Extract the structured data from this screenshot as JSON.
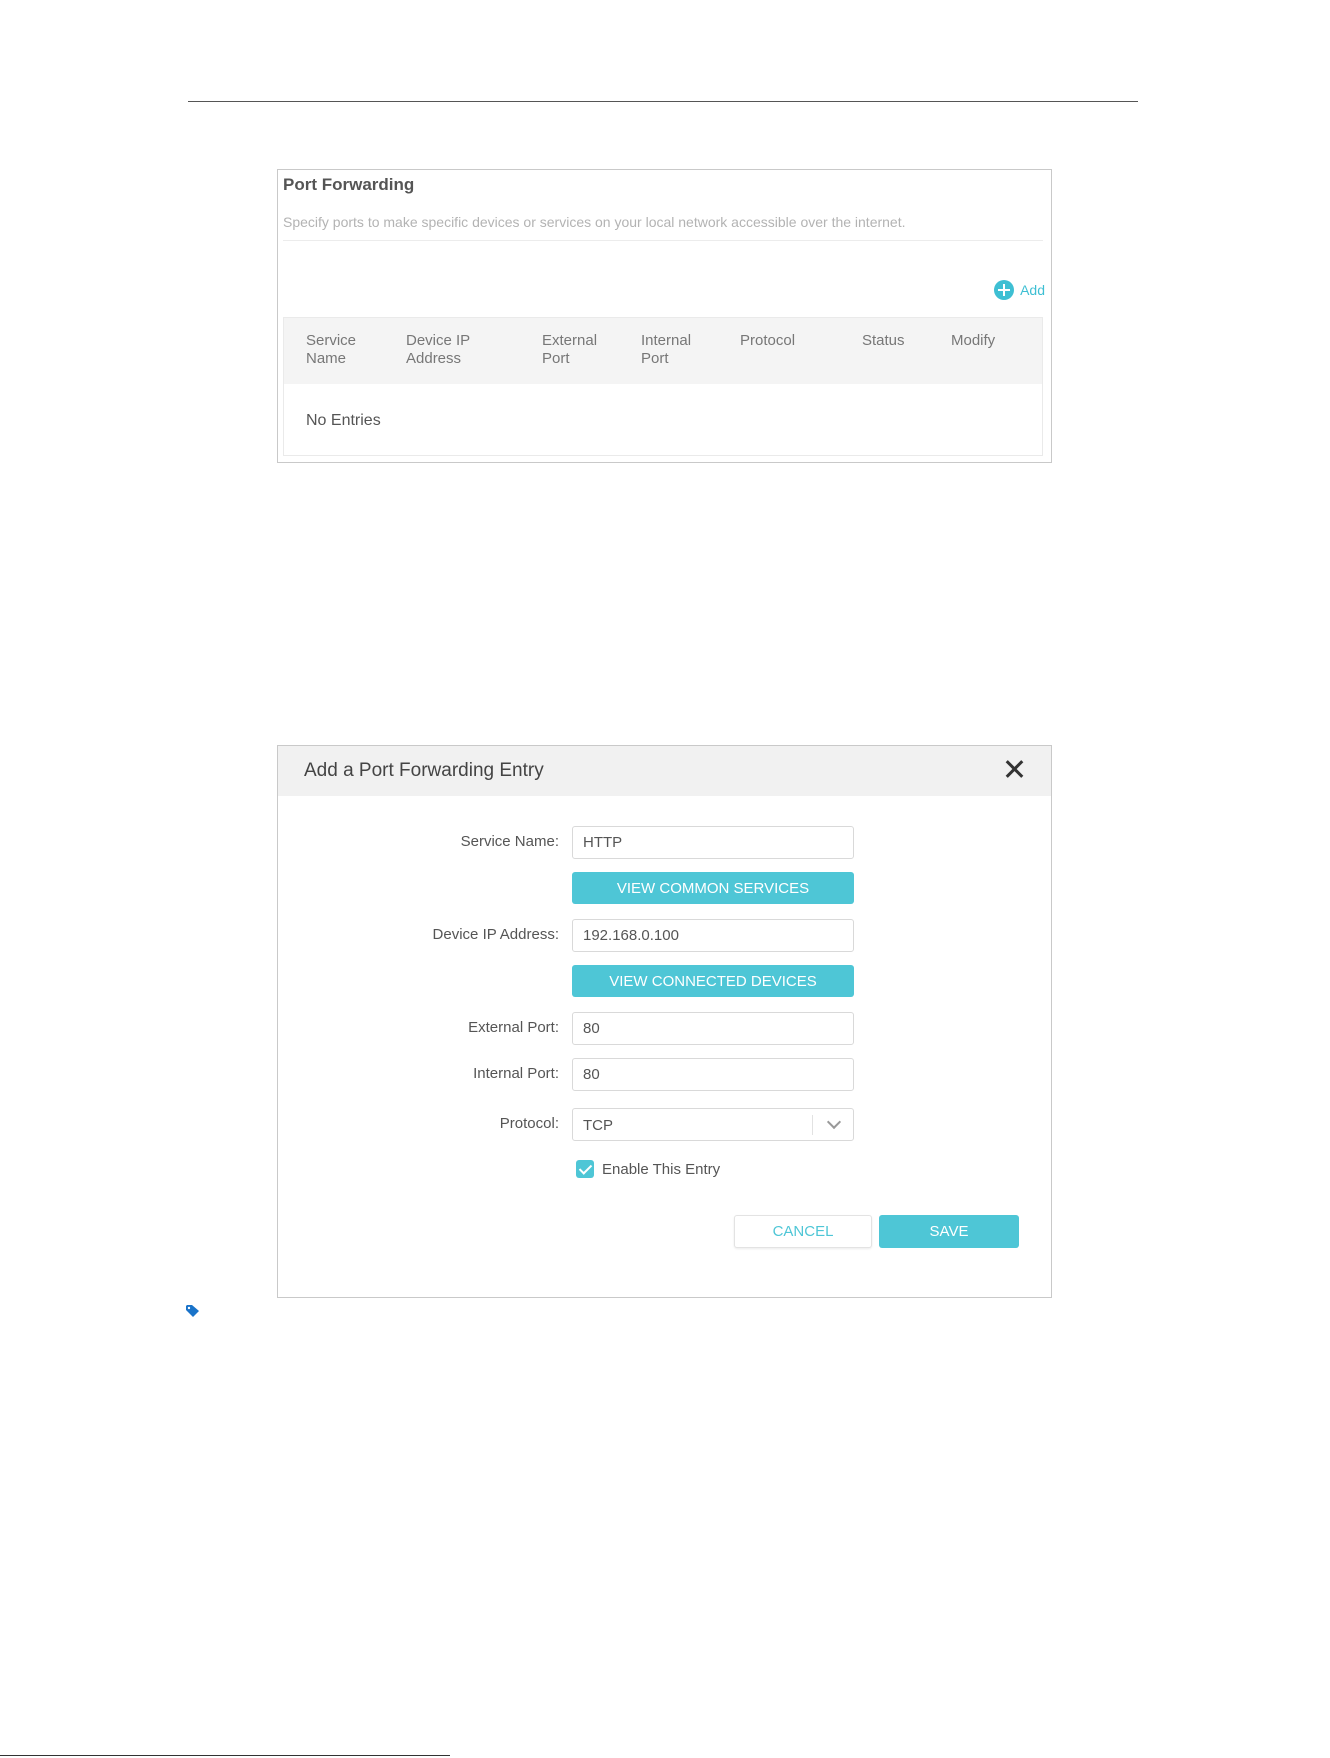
{
  "port_forwarding": {
    "title": "Port Forwarding",
    "description": "Specify ports to make specific devices or services on your local network accessible over the internet.",
    "add_label": "Add",
    "columns": [
      [
        "Service",
        "Name"
      ],
      [
        "Device IP",
        "Address"
      ],
      [
        "External",
        "Port"
      ],
      [
        "Internal",
        "Port"
      ],
      [
        "Protocol"
      ],
      [
        "Status"
      ],
      [
        "Modify"
      ]
    ],
    "empty_text": "No Entries"
  },
  "dialog": {
    "title": "Add a Port Forwarding Entry",
    "service_name": {
      "label": "Service Name:",
      "value": "HTTP"
    },
    "view_common_services": "VIEW COMMON SERVICES",
    "device_ip": {
      "label": "Device IP Address:",
      "value": "192.168.0.100"
    },
    "view_connected_devices": "VIEW CONNECTED DEVICES",
    "external_port": {
      "label": "External Port:",
      "value": "80"
    },
    "internal_port": {
      "label": "Internal Port:",
      "value": "80"
    },
    "protocol": {
      "label": "Protocol:",
      "value": "TCP"
    },
    "enable_entry": {
      "label": "Enable This Entry",
      "checked": true
    },
    "cancel_label": "CANCEL",
    "save_label": "SAVE"
  },
  "colors": {
    "accent": "#4ec6d6",
    "tag_icon": "#1a73c9"
  }
}
